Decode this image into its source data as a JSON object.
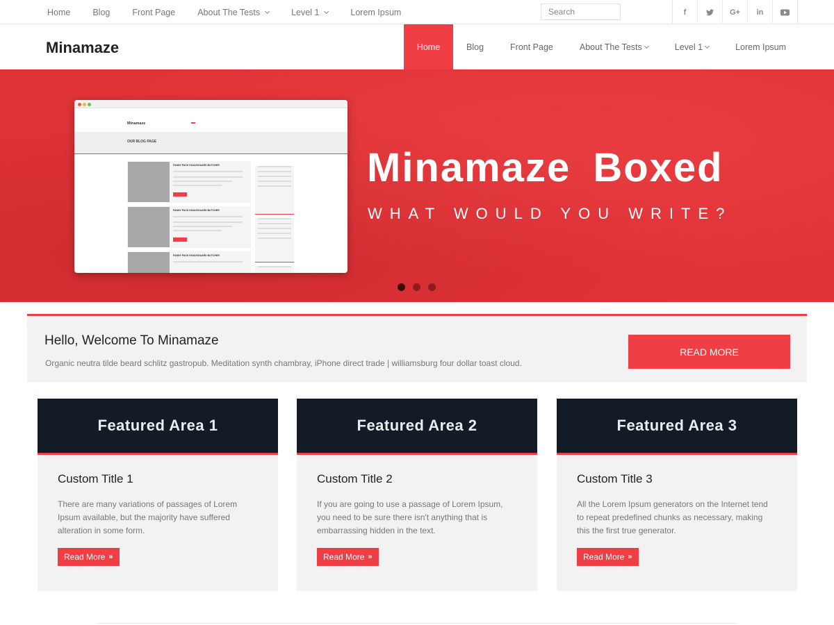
{
  "topbar": {
    "nav": [
      {
        "label": "Home",
        "dropdown": false
      },
      {
        "label": "Blog",
        "dropdown": false
      },
      {
        "label": "Front Page",
        "dropdown": false
      },
      {
        "label": "About The Tests",
        "dropdown": true
      },
      {
        "label": "Level 1",
        "dropdown": true
      },
      {
        "label": "Lorem Ipsum",
        "dropdown": false
      }
    ],
    "search_placeholder": "Search",
    "social": [
      {
        "icon": "facebook-icon",
        "glyph": "f"
      },
      {
        "icon": "twitter-icon",
        "glyph": "ᴛ"
      },
      {
        "icon": "google-plus-icon",
        "glyph": "G+"
      },
      {
        "icon": "linkedin-icon",
        "glyph": "in"
      },
      {
        "icon": "youtube-icon",
        "glyph": "▶"
      }
    ]
  },
  "header": {
    "logo": "Minamaze",
    "nav": [
      {
        "label": "Home",
        "active": true
      },
      {
        "label": "Blog"
      },
      {
        "label": "Front Page"
      },
      {
        "label": "About The Tests",
        "dropdown": true
      },
      {
        "label": "Level 1",
        "dropdown": true
      },
      {
        "label": "Lorem Ipsum"
      }
    ]
  },
  "hero": {
    "title": "Minamaze Boxed",
    "subtitle": "WHAT WOULD YOU WRITE?",
    "slides": 3,
    "active_slide": 1,
    "mockup": {
      "logo": "Minamaze",
      "page_title": "OUR BLOG PAGE",
      "post_title": "FANNY PACK KNAUSGAARD BUTCHER"
    }
  },
  "welcome": {
    "title": "Hello, Welcome To Minamaze",
    "text": "Organic neutra tilde beard schlitz gastropub. Meditation synth chambray, iPhone direct trade | williamsburg four dollar toast cloud.",
    "button": "READ MORE"
  },
  "featured": [
    {
      "banner": "Featured Area 1",
      "title": "Custom Title 1",
      "text": "There are many variations of passages of Lorem Ipsum available, but the majority have suffered alteration in some form.",
      "button": "Read More"
    },
    {
      "banner": "Featured Area 2",
      "title": "Custom Title 2",
      "text": "If you are going to use a passage of Lorem Ipsum, you need to be sure there isn't anything that is embarrassing hidden in the text.",
      "button": "Read More"
    },
    {
      "banner": "Featured Area 3",
      "title": "Custom Title 3",
      "text": "All the Lorem Ipsum generators on the Internet tend to repeat predefined chunks as necessary, making this the first true generator.",
      "button": "Read More"
    }
  ],
  "colors": {
    "accent": "#ef3e44",
    "hero_bg": "#e03338",
    "featured_banner": "#131c26"
  }
}
